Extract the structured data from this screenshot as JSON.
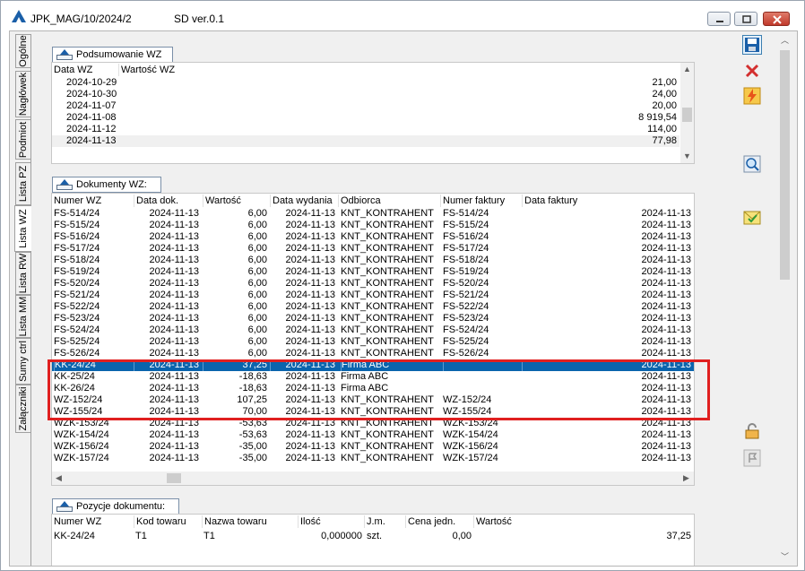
{
  "window": {
    "title": "JPK_MAG/10/2024/2",
    "version": "SD ver.0.1"
  },
  "side_tabs": [
    "Ogólne",
    "Nagłówek",
    "Podmiot",
    "Lista PZ",
    "Lista WZ",
    "Lista RW",
    "Lista MM",
    "Sumy ctrl",
    "Załączniki"
  ],
  "summary": {
    "header": "Podsumowanie WZ",
    "columns": [
      "Data WZ",
      "Wartość WZ"
    ],
    "rows": [
      {
        "date": "2024-10-29",
        "value": "21,00"
      },
      {
        "date": "2024-10-30",
        "value": "24,00"
      },
      {
        "date": "2024-11-07",
        "value": "20,00"
      },
      {
        "date": "2024-11-08",
        "value": "8 919,54"
      },
      {
        "date": "2024-11-12",
        "value": "114,00"
      },
      {
        "date": "2024-11-13",
        "value": "77,98"
      }
    ]
  },
  "documents": {
    "header": "Dokumenty WZ:",
    "columns": [
      "Numer WZ",
      "Data dok.",
      "Wartość",
      "Data wydania",
      "Odbiorca",
      "Numer faktury",
      "Data faktury"
    ],
    "rows": [
      [
        "FS-514/24",
        "2024-11-13",
        "6,00",
        "2024-11-13",
        "KNT_KONTRAHENT",
        "FS-514/24",
        "2024-11-13"
      ],
      [
        "FS-515/24",
        "2024-11-13",
        "6,00",
        "2024-11-13",
        "KNT_KONTRAHENT",
        "FS-515/24",
        "2024-11-13"
      ],
      [
        "FS-516/24",
        "2024-11-13",
        "6,00",
        "2024-11-13",
        "KNT_KONTRAHENT",
        "FS-516/24",
        "2024-11-13"
      ],
      [
        "FS-517/24",
        "2024-11-13",
        "6,00",
        "2024-11-13",
        "KNT_KONTRAHENT",
        "FS-517/24",
        "2024-11-13"
      ],
      [
        "FS-518/24",
        "2024-11-13",
        "6,00",
        "2024-11-13",
        "KNT_KONTRAHENT",
        "FS-518/24",
        "2024-11-13"
      ],
      [
        "FS-519/24",
        "2024-11-13",
        "6,00",
        "2024-11-13",
        "KNT_KONTRAHENT",
        "FS-519/24",
        "2024-11-13"
      ],
      [
        "FS-520/24",
        "2024-11-13",
        "6,00",
        "2024-11-13",
        "KNT_KONTRAHENT",
        "FS-520/24",
        "2024-11-13"
      ],
      [
        "FS-521/24",
        "2024-11-13",
        "6,00",
        "2024-11-13",
        "KNT_KONTRAHENT",
        "FS-521/24",
        "2024-11-13"
      ],
      [
        "FS-522/24",
        "2024-11-13",
        "6,00",
        "2024-11-13",
        "KNT_KONTRAHENT",
        "FS-522/24",
        "2024-11-13"
      ],
      [
        "FS-523/24",
        "2024-11-13",
        "6,00",
        "2024-11-13",
        "KNT_KONTRAHENT",
        "FS-523/24",
        "2024-11-13"
      ],
      [
        "FS-524/24",
        "2024-11-13",
        "6,00",
        "2024-11-13",
        "KNT_KONTRAHENT",
        "FS-524/24",
        "2024-11-13"
      ],
      [
        "FS-525/24",
        "2024-11-13",
        "6,00",
        "2024-11-13",
        "KNT_KONTRAHENT",
        "FS-525/24",
        "2024-11-13"
      ],
      [
        "FS-526/24",
        "2024-11-13",
        "6,00",
        "2024-11-13",
        "KNT_KONTRAHENT",
        "FS-526/24",
        "2024-11-13"
      ],
      [
        "KK-24/24",
        "2024-11-13",
        "37,25",
        "2024-11-13",
        "Firma ABC",
        "",
        "2024-11-13"
      ],
      [
        "KK-25/24",
        "2024-11-13",
        "-18,63",
        "2024-11-13",
        "Firma ABC",
        "",
        "2024-11-13"
      ],
      [
        "KK-26/24",
        "2024-11-13",
        "-18,63",
        "2024-11-13",
        "Firma ABC",
        "",
        "2024-11-13"
      ],
      [
        "WZ-152/24",
        "2024-11-13",
        "107,25",
        "2024-11-13",
        "KNT_KONTRAHENT",
        "WZ-152/24",
        "2024-11-13"
      ],
      [
        "WZ-155/24",
        "2024-11-13",
        "70,00",
        "2024-11-13",
        "KNT_KONTRAHENT",
        "WZ-155/24",
        "2024-11-13"
      ],
      [
        "WZK-153/24",
        "2024-11-13",
        "-53,63",
        "2024-11-13",
        "KNT_KONTRAHENT",
        "WZK-153/24",
        "2024-11-13"
      ],
      [
        "WZK-154/24",
        "2024-11-13",
        "-53,63",
        "2024-11-13",
        "KNT_KONTRAHENT",
        "WZK-154/24",
        "2024-11-13"
      ],
      [
        "WZK-156/24",
        "2024-11-13",
        "-35,00",
        "2024-11-13",
        "KNT_KONTRAHENT",
        "WZK-156/24",
        "2024-11-13"
      ],
      [
        "WZK-157/24",
        "2024-11-13",
        "-35,00",
        "2024-11-13",
        "KNT_KONTRAHENT",
        "WZK-157/24",
        "2024-11-13"
      ]
    ],
    "selected_index": 13
  },
  "positions": {
    "header": "Pozycje dokumentu:",
    "columns": [
      "Numer WZ",
      "Kod towaru",
      "Nazwa towaru",
      "Ilość",
      "J.m.",
      "Cena jedn.",
      "Wartość"
    ],
    "rows": [
      [
        "KK-24/24",
        "T1",
        "T1",
        "0,000000",
        "szt.",
        "0,00",
        "37,25"
      ]
    ]
  },
  "colors": {
    "selection": "#0a64ad",
    "highlight_box": "#e02020"
  },
  "toolbar_icons": [
    "save-icon",
    "delete-icon",
    "lightning-icon",
    "search-icon",
    "envelope-icon",
    "lock-icon",
    "flag-icon"
  ]
}
